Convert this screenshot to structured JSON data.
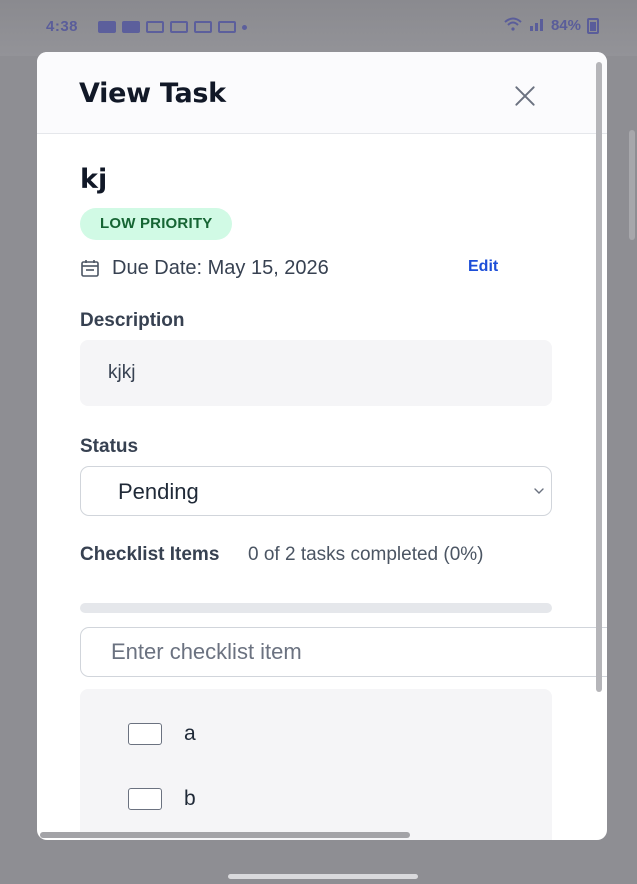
{
  "status_bar": {
    "time": "4:38",
    "battery": "84%"
  },
  "modal": {
    "title": "View Task",
    "close_icon": "close-icon"
  },
  "task": {
    "name": "kj",
    "priority": "LOW PRIORITY",
    "due_date": "Due Date: May 15, 2026",
    "edit_label": "Edit"
  },
  "description": {
    "label": "Description",
    "text": "kjkj"
  },
  "status": {
    "label": "Status",
    "value": "Pending"
  },
  "checklist": {
    "label": "Checklist Items",
    "progress_text": "0 of 2 tasks completed (0%)",
    "progress_fraction": 0,
    "input_placeholder": "Enter checklist item",
    "items": [
      {
        "text": "a",
        "checked": false
      },
      {
        "text": "b",
        "checked": false
      }
    ]
  },
  "colors": {
    "priority_bg": "#d1fae5",
    "priority_text": "#166534",
    "edit_link": "#1d4ed8"
  }
}
